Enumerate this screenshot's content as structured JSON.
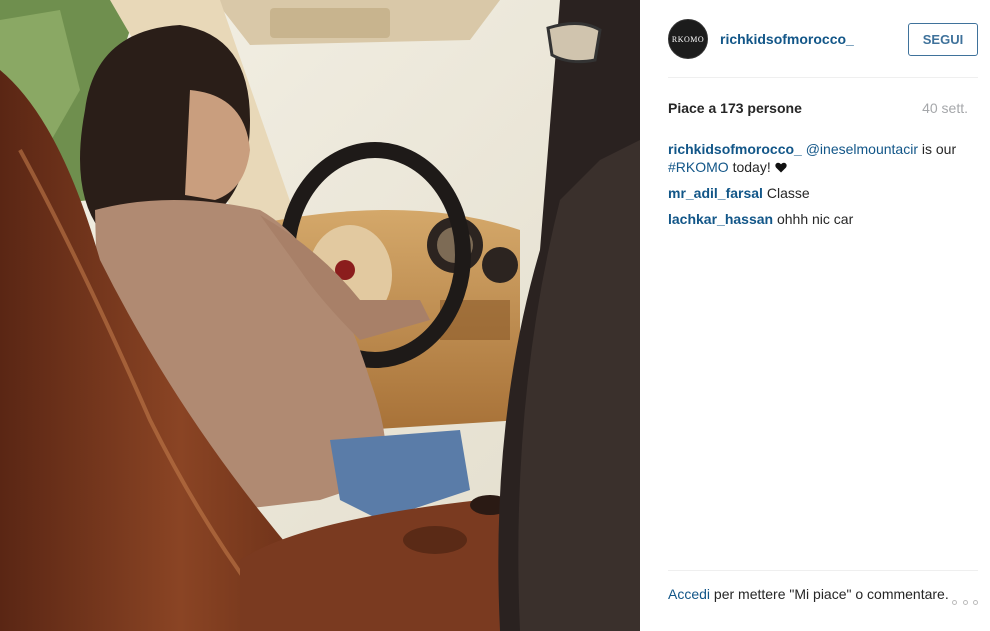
{
  "photo": {
    "alt": "car interior photo"
  },
  "account": {
    "avatar_text": "RKOMO",
    "username": "richkidsofmorocco_",
    "follow_label": "SEGUI"
  },
  "stats": {
    "likes_text": "Piace a 173 persone",
    "time": "40 sett."
  },
  "comments": [
    {
      "user": "richkidsofmorocco_",
      "mention": "@ineselmountacir",
      "text_1": " is our ",
      "hashtag": "#RKOMO",
      "text_2": " today! "
    },
    {
      "user": "mr_adil_farsal",
      "text": " Classe"
    },
    {
      "user": "lachkar_hassan",
      "text": " ohhh nic car"
    }
  ],
  "footer": {
    "login_link": "Accedi",
    "rest": " per mettere \"Mi piace\" o commentare."
  },
  "colors": {
    "link": "#125688",
    "button": "#3f729b",
    "muted": "#a5a7aa"
  },
  "icons": {
    "more": "more-options-icon",
    "heart": "heart-icon"
  }
}
